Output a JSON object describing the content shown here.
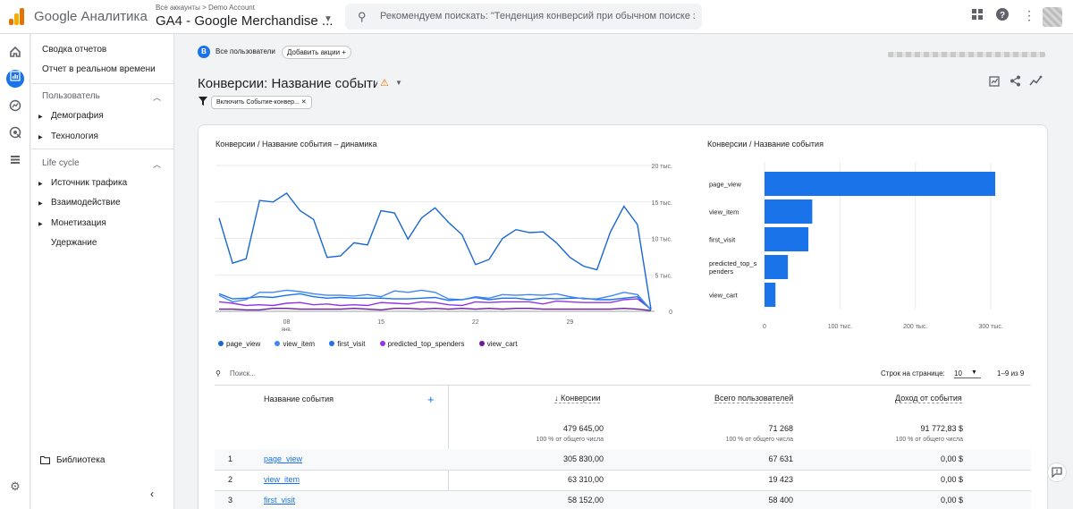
{
  "header": {
    "app_title": "Google Аналитика",
    "crumb": "Все аккаунты > Demo Account",
    "property": "GA4 - Google Merchandise ...",
    "search_placeholder": "Рекомендуем поискать: \"Тенденция конверсий при обычном поиске за ...",
    "icons": [
      "apps-grid-icon",
      "help-icon",
      "more-vert-icon",
      "avatar"
    ]
  },
  "rail_icons": [
    "home-icon",
    "reports-icon",
    "explore-icon",
    "advertising-icon",
    "configure-icon",
    "settings-icon"
  ],
  "nav": {
    "summary": "Сводка отчетов",
    "realtime": "Отчет в реальном времени",
    "section_user": "Пользователь",
    "demography": "Демография",
    "technology": "Технология",
    "section_lifecycle": "Life cycle",
    "acquisition": "Источник трафика",
    "engagement": "Взаимодействие",
    "monetization": "Монетизация",
    "retention": "Удержание",
    "library": "Библиотека"
  },
  "toolbar": {
    "segment_badge": "B",
    "segment": "Все пользователи",
    "add_action": "Добавить акции"
  },
  "page": {
    "title": "Конверсии: Название события",
    "filter_chip": "Включить Событие-конвер..."
  },
  "line_chart": {
    "title": "Конверсии / Название события – динамика",
    "y_ticks": [
      "20 тыс.",
      "15 тыс.",
      "10 тыс.",
      "5 тыс.",
      "0"
    ],
    "x_ticks": [
      "08",
      "15",
      "22",
      "29"
    ],
    "x_sub": "янв."
  },
  "bar_chart": {
    "title": "Конверсии / Название события",
    "x_ticks": [
      "0",
      "100 тыс.",
      "200 тыс.",
      "300 тыс."
    ]
  },
  "chart_data": [
    {
      "type": "line",
      "title": "Конверсии / Название события – динамика",
      "x": [
        "Jan 3",
        "Jan 4",
        "Jan 5",
        "Jan 6",
        "Jan 7",
        "Jan 8",
        "Jan 9",
        "Jan 10",
        "Jan 11",
        "Jan 12",
        "Jan 13",
        "Jan 14",
        "Jan 15",
        "Jan 16",
        "Jan 17",
        "Jan 18",
        "Jan 19",
        "Jan 20",
        "Jan 21",
        "Jan 22",
        "Jan 23",
        "Jan 24",
        "Jan 25",
        "Jan 26",
        "Jan 27",
        "Jan 28",
        "Jan 29",
        "Jan 30",
        "Jan 31",
        "Feb 1"
      ],
      "x_tick_labels": [
        "08",
        "15",
        "22",
        "29"
      ],
      "x_sub_label": "янв.",
      "ylim": [
        0,
        20000
      ],
      "series": [
        {
          "name": "page_view",
          "color": "#1967d2",
          "values": [
            12800,
            6600,
            7200,
            15200,
            15000,
            16200,
            13800,
            12600,
            7400,
            7600,
            9400,
            9100,
            13800,
            13500,
            9900,
            12800,
            14200,
            12200,
            10500,
            6400,
            7100,
            10000,
            11200,
            10800,
            10900,
            9400,
            7400,
            6200,
            5700,
            10900,
            14400,
            11900,
            300
          ]
        },
        {
          "name": "view_item",
          "color": "#4285f4",
          "values": [
            2200,
            1300,
            1600,
            2600,
            2600,
            2900,
            2700,
            2400,
            2200,
            2200,
            2100,
            2300,
            2000,
            2800,
            2600,
            2900,
            2600,
            1700,
            1600,
            2000,
            1800,
            2300,
            2200,
            2300,
            2200,
            2400,
            2000,
            1700,
            1700,
            2100,
            2600,
            2300,
            200
          ]
        },
        {
          "name": "first_visit",
          "color": "#1a73e8",
          "values": [
            2400,
            1700,
            1800,
            2000,
            1900,
            2200,
            2400,
            2000,
            1800,
            1900,
            1800,
            1800,
            1800,
            1700,
            1700,
            1800,
            1900,
            1500,
            1600,
            1900,
            1600,
            1800,
            1800,
            1600,
            1800,
            1700,
            1800,
            1800,
            1600,
            1600,
            1800,
            2000,
            200
          ]
        },
        {
          "name": "predicted_top_spenders",
          "color": "#9334e6",
          "values": [
            1300,
            1100,
            800,
            900,
            800,
            1100,
            1200,
            900,
            1000,
            800,
            900,
            800,
            1200,
            1100,
            1000,
            1300,
            1200,
            900,
            800,
            1300,
            1200,
            1300,
            1300,
            1300,
            1000,
            1400,
            1300,
            1200,
            1200,
            1200,
            1600,
            1700,
            300
          ]
        },
        {
          "name": "view_cart",
          "color": "#6a1b9a",
          "values": [
            300,
            300,
            200,
            200,
            400,
            400,
            300,
            300,
            300,
            300,
            400,
            300,
            200,
            400,
            400,
            300,
            400,
            300,
            400,
            300,
            400,
            300,
            400,
            400,
            300,
            300,
            300,
            300,
            300,
            300,
            400,
            300,
            100
          ]
        }
      ]
    },
    {
      "type": "bar",
      "orientation": "horizontal",
      "title": "Конверсии / Название события",
      "categories": [
        "page_view",
        "view_item",
        "first_visit",
        "predicted_top_spenders",
        "view_cart"
      ],
      "values": [
        305830,
        63310,
        58152,
        31000,
        14500
      ],
      "xlim": [
        0,
        320000
      ],
      "color": "#1a73e8"
    }
  ],
  "table": {
    "search_placeholder": "Поиск...",
    "rows_per_page_label": "Строк на странице:",
    "rows_per_page": "10",
    "pagination": "1–9 из 9",
    "col_event": "Название события",
    "col_conversions": "Конверсии",
    "col_users": "Всего пользователей",
    "col_revenue": "Доход от события",
    "totals": {
      "conversions": "479 645,00",
      "users": "71 268",
      "revenue": "91 772,83 $",
      "pct_text": "100 % от общего числа"
    },
    "rows": [
      {
        "n": "1",
        "event": "page_view",
        "conv": "305 830,00",
        "users": "67 631",
        "rev": "0,00 $"
      },
      {
        "n": "2",
        "event": "view_item",
        "conv": "63 310,00",
        "users": "19 423",
        "rev": "0,00 $"
      },
      {
        "n": "3",
        "event": "first_visit",
        "conv": "58 152,00",
        "users": "58 400",
        "rev": "0,00 $"
      }
    ]
  }
}
